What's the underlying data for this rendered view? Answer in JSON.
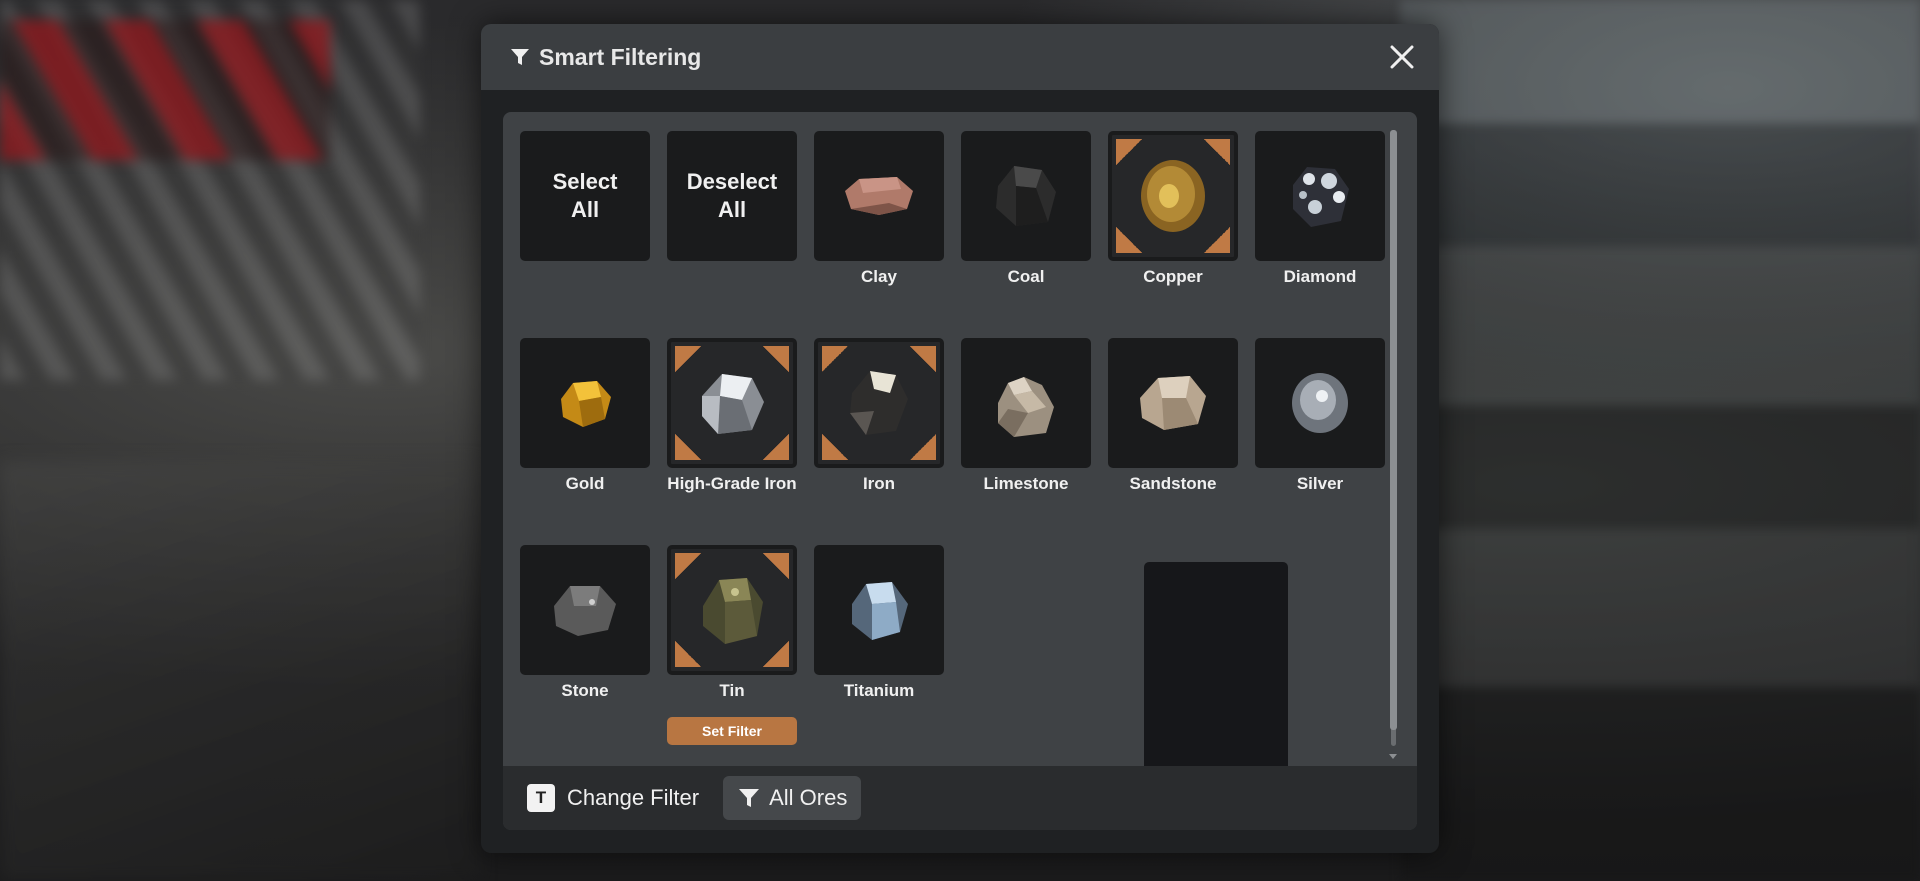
{
  "window": {
    "title": "Smart Filtering",
    "close_label": "close"
  },
  "actions": {
    "select_all": "Select\nAll",
    "deselect_all": "Deselect\nAll"
  },
  "ores": [
    {
      "name": "Clay",
      "selected": false,
      "color": "#b07a6a"
    },
    {
      "name": "Coal",
      "selected": false,
      "color": "#2a2a2a"
    },
    {
      "name": "Copper",
      "selected": true,
      "color": "#a87a2e"
    },
    {
      "name": "Diamond",
      "selected": false,
      "color": "#3c3f48"
    },
    {
      "name": "Gold",
      "selected": false,
      "color": "#d8a22a"
    },
    {
      "name": "High-Grade Iron",
      "selected": true,
      "color": "#b8bcc2"
    },
    {
      "name": "Iron",
      "selected": true,
      "color": "#4a4848"
    },
    {
      "name": "Limestone",
      "selected": false,
      "color": "#b8aa98"
    },
    {
      "name": "Sandstone",
      "selected": false,
      "color": "#c9b8a2"
    },
    {
      "name": "Silver",
      "selected": false,
      "color": "#9aa0a8"
    },
    {
      "name": "Stone",
      "selected": false,
      "color": "#6c6c6c"
    },
    {
      "name": "Tin",
      "selected": true,
      "color": "#6a6842"
    },
    {
      "name": "Titanium",
      "selected": false,
      "color": "#a9c6df"
    }
  ],
  "focused": {
    "ore": "Tin",
    "button_label": "Set Filter"
  },
  "footer": {
    "key": "T",
    "change_filter_label": "Change Filter",
    "filter_button_label": "All Ores"
  },
  "colors": {
    "accent": "#c07a45",
    "tile_bg": "#1a1b1c",
    "panel_bg": "#3f4245",
    "header_bg": "#3b3e41"
  }
}
